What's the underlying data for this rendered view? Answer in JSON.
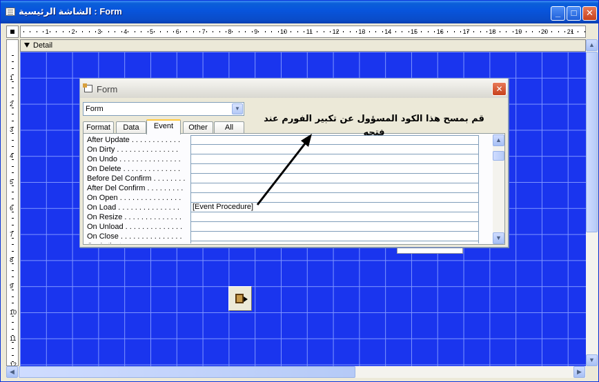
{
  "window": {
    "title": "الشاشة الرئيسية : Form",
    "minimize": "_",
    "maximize": "□",
    "close": "✕"
  },
  "ruler": {
    "h_numbers": [
      "1",
      "2",
      "3",
      "4",
      "5",
      "6",
      "7",
      "8",
      "9",
      "10",
      "11",
      "12",
      "13",
      "14",
      "15",
      "16",
      "17",
      "18",
      "19",
      "20",
      "21"
    ],
    "v_numbers": [
      "1",
      "2",
      "3",
      "4",
      "5",
      "6",
      "7",
      "8",
      "9",
      "10",
      "11",
      "12"
    ]
  },
  "section": {
    "detail_label": "Detail"
  },
  "property_sheet": {
    "title": "Form",
    "close": "✕",
    "object_select": "Form",
    "tabs": [
      "Format",
      "Data",
      "Event",
      "Other",
      "All"
    ],
    "selected_tab": "Event",
    "rows": [
      {
        "name": "After Update . . . . . . . . . . . .",
        "value": ""
      },
      {
        "name": "On Dirty . . . . . . . . . . . . . . .",
        "value": ""
      },
      {
        "name": "On Undo . . . . . . . . . . . . . . .",
        "value": ""
      },
      {
        "name": "On Delete . . . . . . . . . . . . . .",
        "value": ""
      },
      {
        "name": "Before Del Confirm . . . . . . . .",
        "value": ""
      },
      {
        "name": "After Del Confirm . . . . . . . . .",
        "value": ""
      },
      {
        "name": "On Open . . . . . . . . . . . . . . .",
        "value": ""
      },
      {
        "name": "On Load . . . . . . . . . . . . . . .",
        "value": "[Event Procedure]"
      },
      {
        "name": "On Resize . . . . . . . . . . . . . .",
        "value": ""
      },
      {
        "name": "On Unload . . . . . . . . . . . . . .",
        "value": ""
      },
      {
        "name": "On Close . . . . . . . . . . . . . . .",
        "value": ""
      },
      {
        "name": "On Activate . . . . . . . . . . . . .",
        "value": ""
      }
    ]
  },
  "annotation": {
    "line1": "قم بمسح هذا الكود المسؤول عن تكبير الفورم عند",
    "line2": "فتحه"
  },
  "icons": {
    "exit_button": "exit-door-icon",
    "ruler_corner": "form-selector-icon"
  }
}
